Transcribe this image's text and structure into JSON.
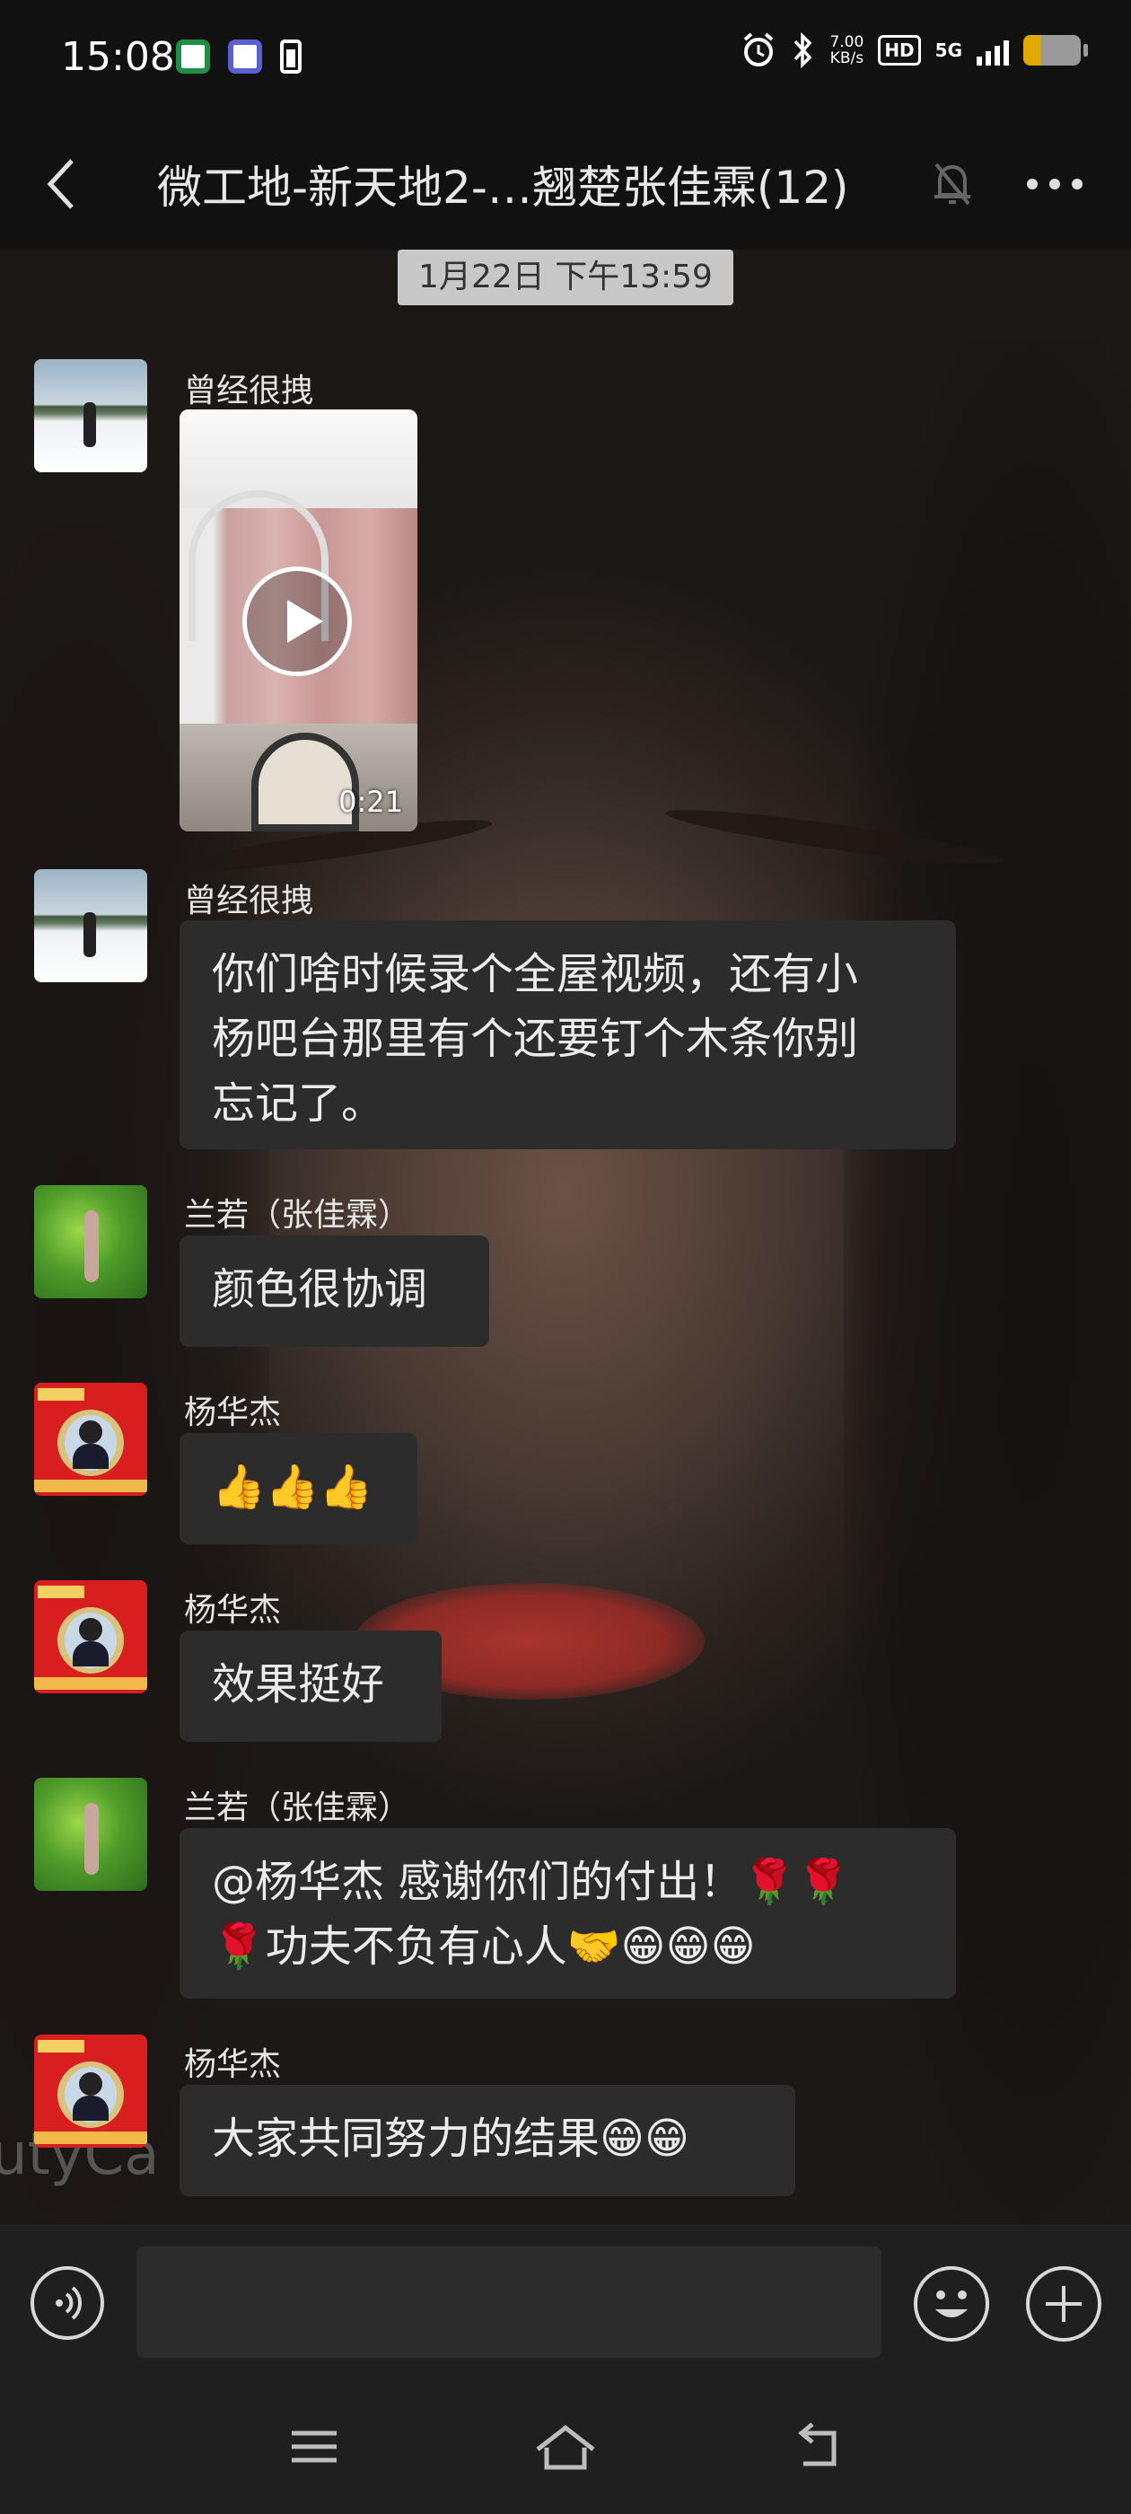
{
  "status_bar": {
    "time": "15:08",
    "net_speed_value": "7.00",
    "net_speed_unit": "KB/s",
    "hd_label": "HD",
    "network": "5G",
    "icons": [
      "app-icon",
      "app-icon",
      "battery-small-icon",
      "alarm-icon",
      "bluetooth-icon",
      "signal-icon",
      "battery-icon"
    ]
  },
  "header": {
    "title": "微工地-新天地2-…翘楚张佳霖(12)"
  },
  "chat": {
    "timestamp": "1月22日  下午13:59",
    "watermark": "utyCa",
    "messages": [
      {
        "sender": "曾经很拽",
        "type": "video",
        "duration": "0:21"
      },
      {
        "sender": "曾经很拽",
        "type": "text",
        "line1": "你们啥时候录个全屋视频，还有小",
        "line2": "杨吧台那里有个还要钉个木条你别",
        "line3": "忘记了。"
      },
      {
        "sender": "兰若（张佳霖）",
        "type": "text",
        "text": "颜色很协调"
      },
      {
        "sender": "杨华杰",
        "type": "emoji",
        "text": "👍👍👍"
      },
      {
        "sender": "杨华杰",
        "type": "text",
        "text": "效果挺好"
      },
      {
        "sender": "兰若（张佳霖）",
        "type": "text",
        "line1": "@杨华杰  感谢你们的付出！🌹🌹",
        "line2": "🌹功夫不负有心人🤝😁😁😁"
      },
      {
        "sender": "杨华杰",
        "type": "text",
        "text": "大家共同努力的结果😁😁"
      }
    ]
  },
  "input_bar": {
    "placeholder": ""
  },
  "colors": {
    "bubble": "#2c2c2c",
    "bar": "#1f1f1f",
    "timestamp_bg": "#c8c8c8"
  }
}
